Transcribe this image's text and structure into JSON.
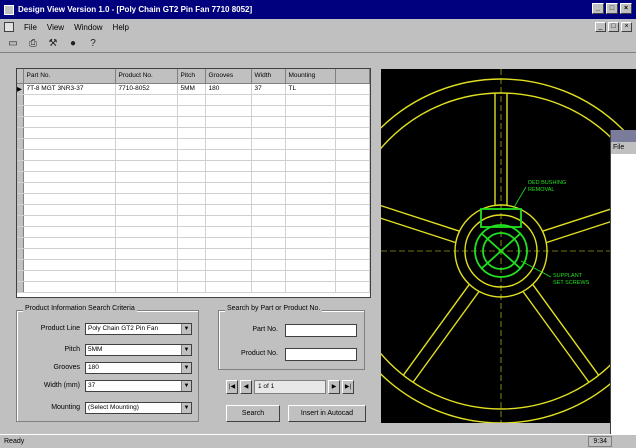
{
  "window": {
    "title": "Design View Version 1.0 - [Poly Chain GT2 Pin Fan 7710 8052]"
  },
  "menu": {
    "items": [
      "File",
      "View",
      "Window",
      "Help"
    ]
  },
  "toolbar": {
    "icons": [
      "new-icon",
      "print-icon",
      "tools-icon",
      "camera-icon",
      "help-icon"
    ]
  },
  "grid": {
    "columns": [
      "Part No.",
      "Product No.",
      "Pitch",
      "Grooves",
      "Width",
      "Mounting"
    ],
    "rows": [
      [
        "7T-8 MGT 3NR3-37",
        "7710-8052",
        "5MM",
        "180",
        "37",
        "TL"
      ]
    ]
  },
  "product_filter": {
    "title": "Product Information Search Criteria",
    "product_line_label": "Product Line",
    "product_line_value": "Poly Chain GT2 Pin Fan",
    "pitch_label": "Pitch",
    "pitch_value": "5MM",
    "grooves_label": "Grooves",
    "grooves_value": "180",
    "width_label": "Width (mm)",
    "width_value": "37",
    "mounting_label": "Mounting",
    "mounting_value": "(Select Mounting)"
  },
  "part_search": {
    "title": "Search by Part or Product No.",
    "part_label": "Part No.",
    "product_label": "Product No."
  },
  "navigator": {
    "record_text": "1 of 1"
  },
  "buttons": {
    "search": "Search",
    "insert": "Insert in Autocad"
  },
  "drawing": {
    "annotation_1": [
      "DED BUSHING",
      "REMOVAL"
    ],
    "annotation_2": [
      "SUPPLANT",
      "SET SCREWS"
    ]
  },
  "side_window": {
    "menu": "File"
  },
  "status": {
    "left": "Ready",
    "time": "9:34"
  }
}
